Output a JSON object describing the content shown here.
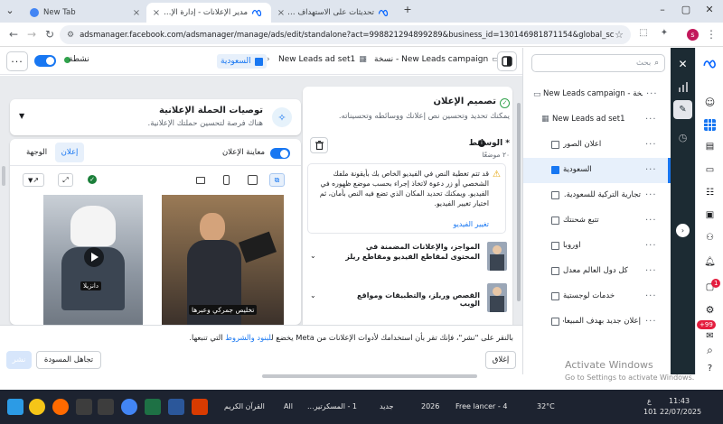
{
  "browser": {
    "tabs": [
      {
        "title": "New Tab"
      },
      {
        "title": "مدير الإعلانات - إدارة الإعلانات"
      },
      {
        "title": "تحديثات على الاستهداف التفصيلي"
      }
    ],
    "url": "adsmanager.facebook.com/adsmanager/manage/ads/edit/standalone?act=998821294899289&business_id=130146981871154&global_scope_id=1301469818...",
    "profile_initial": "s"
  },
  "header": {
    "status_label": "نشطة",
    "breadcrumb": [
      {
        "label": "New Leads campaign - نسخة"
      },
      {
        "label": "New Leads ad set1"
      },
      {
        "label": "السعودية"
      }
    ]
  },
  "recommendations": {
    "title": "توصيات الحملة الإعلانية",
    "subtitle": "هناك فرصة لتحسين حملتك الإعلانية."
  },
  "preview": {
    "toggle_label": "معاينة الإعلان",
    "tab_ad": "إعلان",
    "tab_destination": "الوجهة",
    "card1_caption": "تخليص جمركي وعبرها",
    "card2_caption": "دانزيلا"
  },
  "design": {
    "title": "تصميم الإعلان",
    "subtitle": "يمكنك تحديد وتحسين نص إعلانك ووسائطه وتحسيناته.",
    "media_label": "* الوسائط",
    "media_count": "٢٠ موضعًا",
    "warning_text": "قد تتم تغطية النص في الفيديو الخاص بك بأيقونة ملفك الشخصي أو زر دعوة لاتخاذ إجراء بحسب موضع ظهوره في الفيديو. ويمكنك تحديد المكان الذي تضع فيه النص بأمان، ثم اختيار تغيير الفيديو.",
    "warning_link": "تغيير الفيديو",
    "placements": [
      {
        "label": "المواجز، والإعلانات المضمنة في المحتوى لمقاطع الفيديو ومقاطع ريلز"
      },
      {
        "label": "القصص وريلز، والتطبيقات ومواقع الويب"
      }
    ]
  },
  "footer": {
    "terms_text_prefix": "بالنقر على \"نشر\"، فإنك تقر بأن استخدامك لأدوات الإعلانات من Meta يخضع ل",
    "terms_link": "لبنود والشروط",
    "terms_text_suffix": " التي تنبعها.",
    "close_label": "إغلاق",
    "discard_label": "تجاهل المسودة",
    "publish_label": "نشر"
  },
  "tree": {
    "search_placeholder": "بحث",
    "campaign": "New Leads campaign - نسخة",
    "adset": "New Leads ad set1",
    "ads": [
      {
        "label": "اعلان الصور"
      },
      {
        "label": "السعودية"
      },
      {
        "label": "تجارية التركية للسعودية..."
      },
      {
        "label": "تتبع شحنتك"
      },
      {
        "label": "اوروبا"
      },
      {
        "label": "كل دول العالم معدل"
      },
      {
        "label": "خدمات لوجستية"
      },
      {
        "label": "إعلان جديد بهدف المبيعات"
      }
    ]
  },
  "rail": {
    "notif_badge": "1",
    "msg_badge": "+99"
  },
  "os": {
    "activate_title": "Activate Windows",
    "activate_sub": "Go to Settings to activate Windows.",
    "taskbar_items": [
      {
        "label": "القرآن الكريم"
      },
      {
        "label": "All"
      },
      {
        "label": "1 - المسكرتير..."
      },
      {
        "label": "جديد"
      },
      {
        "label": "2026"
      },
      {
        "label": "4 - Free lancer"
      }
    ],
    "weather": "32°C",
    "lang": "ع",
    "volume": "101",
    "time": "11:43",
    "date": "22/07/2025"
  },
  "colors": {
    "accent": "#1877f2",
    "rail_dark": "#1c2b33",
    "warning": "#f7b928"
  }
}
